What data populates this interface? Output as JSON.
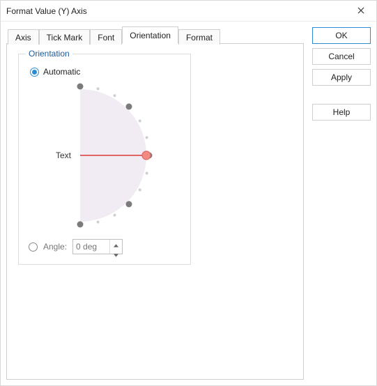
{
  "window": {
    "title": "Format Value (Y) Axis"
  },
  "tabs": [
    {
      "label": "Axis"
    },
    {
      "label": "Tick Mark"
    },
    {
      "label": "Font"
    },
    {
      "label": "Orientation"
    },
    {
      "label": "Format"
    }
  ],
  "active_tab_index": 3,
  "orientation_panel": {
    "group_label": "Orientation",
    "automatic_label": "Automatic",
    "automatic_selected": true,
    "dial": {
      "sample_text": "Text",
      "current_angle_deg": 0,
      "major_stops_deg": [
        -90,
        -45,
        0,
        45,
        90
      ],
      "minor_step_deg": 15,
      "colors": {
        "bg": "#f1ebf3",
        "major_dot": "#7b7b7b",
        "minor_dot": "#cfcfcf",
        "needle": "#e06666",
        "knob_fill": "#f28b82",
        "knob_stroke": "#e06666"
      }
    },
    "angle_label": "Angle:",
    "angle_selected": false,
    "angle_value": "0 deg"
  },
  "buttons": {
    "ok": "OK",
    "cancel": "Cancel",
    "apply": "Apply",
    "help": "Help"
  }
}
